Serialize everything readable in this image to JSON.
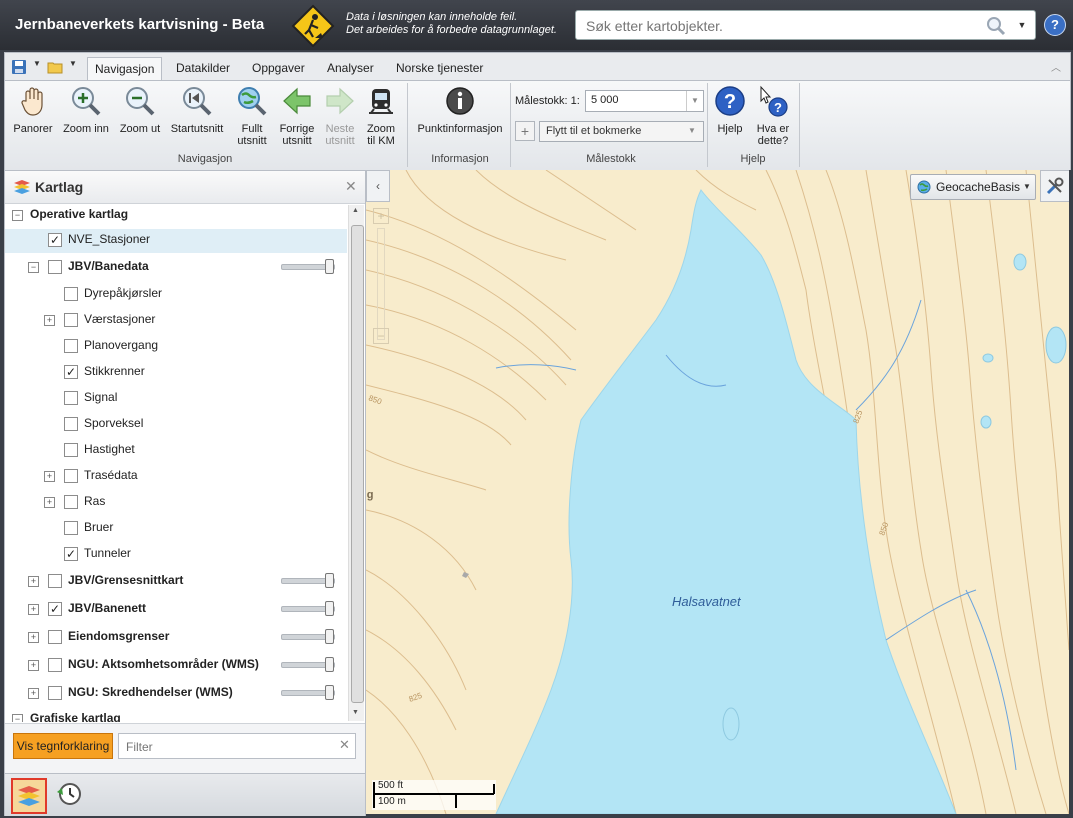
{
  "app": {
    "title": "Jernbaneverkets kartvisning - Beta",
    "notice_line1": "Data i løsningen kan inneholde feil.",
    "notice_line2": "Det arbeides for å forbedre datagrunnlaget."
  },
  "search": {
    "placeholder": "Søk etter kartobjekter."
  },
  "ribbon": {
    "tabs": [
      "Navigasjon",
      "Datakilder",
      "Oppgaver",
      "Analyser",
      "Norske tjenester"
    ],
    "active_tab": "Navigasjon",
    "buttons": {
      "pan": "Panorer",
      "zoom_in": "Zoom inn",
      "zoom_out": "Zoom ut",
      "start": "Startutsnitt",
      "full_1": "Fullt",
      "full_2": "utsnitt",
      "prev_1": "Forrige",
      "prev_2": "utsnitt",
      "next_1": "Neste",
      "next_2": "utsnitt",
      "km_1": "Zoom",
      "km_2": "til KM",
      "point_info": "Punktinformasjon",
      "help": "Hjelp",
      "what_1": "Hva er",
      "what_2": "dette?"
    },
    "groups": {
      "nav": "Navigasjon",
      "info": "Informasjon",
      "scale": "Målestokk",
      "help": "Hjelp"
    },
    "scale": {
      "label": "Målestokk: 1:",
      "value": "5 000",
      "bookmark_placeholder": "Flytt til et bokmerke"
    }
  },
  "panel": {
    "title": "Kartlag",
    "legend_button": "Vis tegnforklaring",
    "filter_placeholder": "Filter",
    "rows": [
      {
        "label": "Operative kartlag",
        "bold": true
      },
      {
        "label": "NVE_Stasjoner",
        "checked": true
      },
      {
        "label": "JBV/Banedata",
        "bold": true
      },
      {
        "label": "Dyrepåkjørsler"
      },
      {
        "label": "Værstasjoner"
      },
      {
        "label": "Planovergang"
      },
      {
        "label": "Stikkrenner",
        "checked": true
      },
      {
        "label": "Signal"
      },
      {
        "label": "Sporveksel"
      },
      {
        "label": "Hastighet"
      },
      {
        "label": "Trasédata"
      },
      {
        "label": "Ras"
      },
      {
        "label": "Bruer"
      },
      {
        "label": "Tunneler",
        "checked": true
      },
      {
        "label": "JBV/Grensesnittkart",
        "bold": true
      },
      {
        "label": "JBV/Banenett",
        "bold": true,
        "checked": true
      },
      {
        "label": "Eiendomsgrenser",
        "bold": true
      },
      {
        "label": "NGU: Aktsomhetsområder (WMS)",
        "bold": true
      },
      {
        "label": "NGU: Skredhendelser (WMS)",
        "bold": true
      },
      {
        "label": "Grafiske kartlag",
        "bold": true
      }
    ]
  },
  "map": {
    "basemap": "GeocacheBasis",
    "lake_label": "Halsavatnet",
    "contour_labels": [
      "850",
      "825",
      "850",
      "825"
    ],
    "partial_label": "ug",
    "scalebar_ft": "500 ft",
    "scalebar_m": "100 m"
  },
  "colors": {
    "titlebar": "#2b2e34",
    "accent_orange": "#f6a022",
    "lake": "#b3e5f5",
    "land": "#f8eccc",
    "contour": "#d9b98a"
  }
}
